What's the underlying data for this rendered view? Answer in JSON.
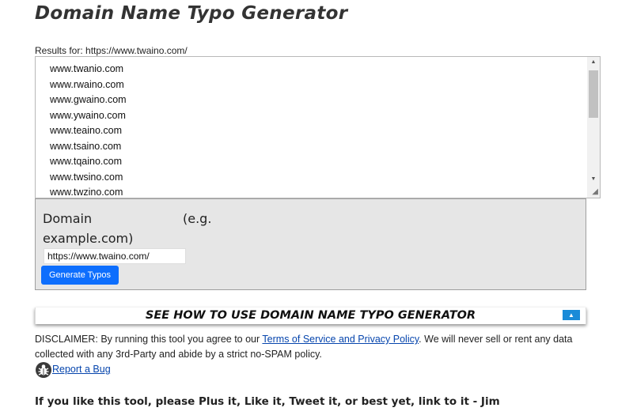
{
  "page": {
    "title": "Domain Name Typo Generator"
  },
  "results": {
    "label": "Results for: https://www.twaino.com/",
    "items": [
      "www.twanio.com",
      "www.rwaino.com",
      "www.gwaino.com",
      "www.ywaino.com",
      "www.teaino.com",
      "www.tsaino.com",
      "www.tqaino.com",
      "www.twsino.com",
      "www.twzino.com"
    ]
  },
  "form": {
    "label_domain": "Domain",
    "label_eg": "(e.g.",
    "label_example": "example.com)",
    "input_value": "https://www.twaino.com/",
    "button_label": "Generate Typos"
  },
  "howto": {
    "title": "SEE HOW TO USE DOMAIN NAME TYPO GENERATOR",
    "toggle_glyph": "▲"
  },
  "disclaimer": {
    "prefix": "DISCLAIMER: By running this tool you agree to our ",
    "link_text": "Terms of Service and Privacy Policy",
    "suffix": ". We will never sell or rent any data collected with any 3rd-Party and abide by a strict no-SPAM policy."
  },
  "bug": {
    "link_text": "Report a Bug",
    "icon": "bug-icon"
  },
  "footer": {
    "text": "If you like this tool, please Plus it, Like it, Tweet it, or best yet, link to it - Jim"
  },
  "colors": {
    "button_bg": "#0d6efd",
    "toggle_bg": "#1a8bd8",
    "panel_bg": "#e6e6e6",
    "link": "#0645ad"
  }
}
